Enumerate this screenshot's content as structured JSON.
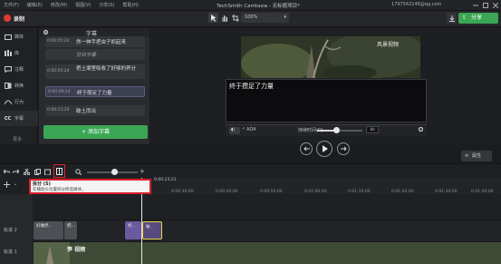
{
  "menu": {
    "items": [
      "文件(F)",
      "编辑(E)",
      "修改(M)",
      "视图(V)",
      "分享(S)",
      "帮助(H)"
    ],
    "app_title": "TechSmith Camtasia - 无标题项目*",
    "account": "1797542148@qq.com"
  },
  "toolbar": {
    "record_label": "录制",
    "zoom_value": "100%",
    "export_label": "分享",
    "accent": "#3aa654",
    "record_color": "#e03a30"
  },
  "leftnav": {
    "items": [
      {
        "label": "媒体",
        "icon": "media-icon"
      },
      {
        "label": "库",
        "icon": "library-icon"
      },
      {
        "label": "注释",
        "icon": "annotations-icon"
      },
      {
        "label": "转换",
        "icon": "transitions-icon"
      },
      {
        "label": "行为",
        "icon": "behaviors-icon"
      },
      {
        "label": "字幕",
        "icon": "captions-icon"
      }
    ],
    "more_label": "更多"
  },
  "captions": {
    "title": "字幕",
    "rows": [
      {
        "time": "0:00:05;24",
        "text": "然一伸手把虫子抓起来"
      },
      {
        "time": "",
        "text": "空白字幕"
      },
      {
        "time": "0:00:05;24",
        "text": "把土壤里吸收了好够的养分"
      },
      {
        "time": "0:00:09;24",
        "text": "终于攒足了力量"
      },
      {
        "time": "0:00:23;24",
        "text": "破土而出"
      }
    ],
    "add_label": "+ 添加字幕"
  },
  "preview": {
    "watermark": "风景视频",
    "caption_text": "终于攒足了力量",
    "ada_label": "ADA",
    "duration_label": "持续时间(D)",
    "duration_value": "4s"
  },
  "properties_label": "属性",
  "timeline": {
    "playhead_time": "0:00:23;21",
    "tick_labels": [
      "0:00:30;00",
      "0:00:40;00",
      "0:00:50;00",
      "0:01:00;00",
      "0:01:10;00",
      "0:01:20;00",
      "0:01:30;00",
      "0:01:40;00"
    ],
    "tooltip_title": "拆分 (S)",
    "tooltip_desc": "在播放头位置拆分所选媒体。",
    "track2_label": "轨道 2",
    "track1_label": "轨道 1",
    "clips": [
      {
        "label": "好做然…",
        "kind": "caption"
      },
      {
        "label": "把…",
        "kind": "caption"
      },
      {
        "label": "终…",
        "kind": "purple"
      },
      {
        "label": "破…",
        "kind": "purple2"
      }
    ],
    "video_clip_label": "笋 视频"
  }
}
